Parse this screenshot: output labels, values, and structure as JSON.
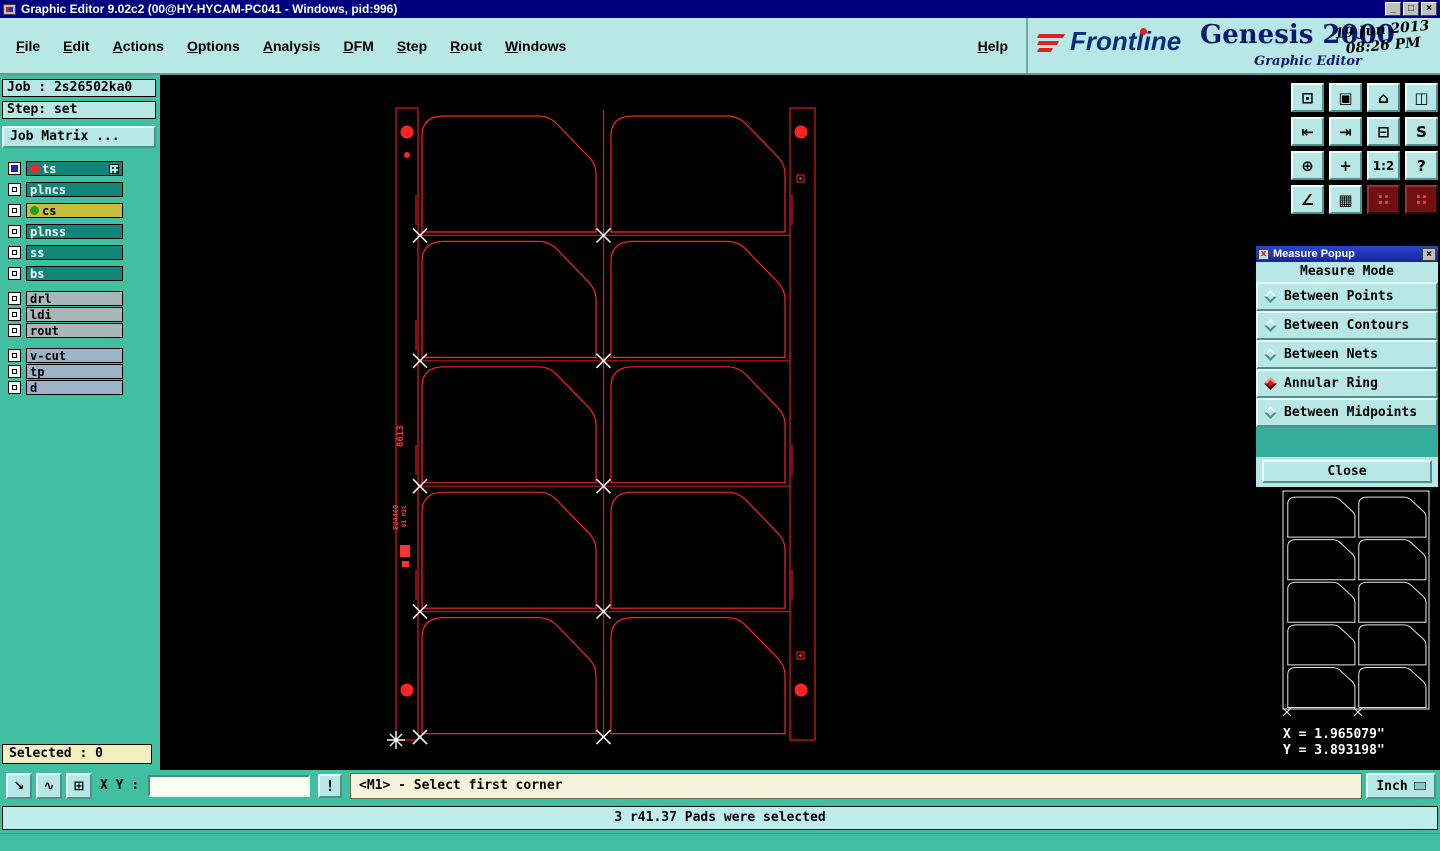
{
  "window": {
    "title": "Graphic Editor 9.02c2 (00@HY-HYCAM-PC041 - Windows, pid:996)",
    "minimize": "_",
    "maximize": "□",
    "close": "×"
  },
  "menubar": {
    "items": [
      "File",
      "Edit",
      "Actions",
      "Options",
      "Analysis",
      "DFM",
      "Step",
      "Rout",
      "Windows"
    ],
    "help": "Help"
  },
  "brand": {
    "name": "Frontline",
    "product": "Genesis 2000",
    "date": "19 Jun 2013",
    "time": "08:26 PM",
    "subtitle": "Graphic Editor"
  },
  "sidebar": {
    "job": "Job : 2s26502ka0",
    "step": "Step: set",
    "job_matrix": "Job Matrix ...",
    "selected": "Selected : 0",
    "layers": [
      {
        "name": "ts"
      },
      {
        "name": "plncs"
      },
      {
        "name": "cs"
      },
      {
        "name": "plnss"
      },
      {
        "name": "ss"
      },
      {
        "name": "bs"
      },
      {
        "name": "drl"
      },
      {
        "name": "ldi"
      },
      {
        "name": "rout"
      },
      {
        "name": "v-cut"
      },
      {
        "name": "tp"
      },
      {
        "name": "d"
      }
    ]
  },
  "toolbar": {
    "buttons": [
      {
        "glyph": "⊡"
      },
      {
        "glyph": "▣"
      },
      {
        "glyph": "⌂"
      },
      {
        "glyph": "◫"
      },
      {
        "glyph": "⇤"
      },
      {
        "glyph": "⇥"
      },
      {
        "glyph": "⊟"
      },
      {
        "glyph": "S"
      },
      {
        "glyph": "⊕"
      },
      {
        "glyph": "+"
      },
      {
        "glyph": "1:2"
      },
      {
        "glyph": "?"
      },
      {
        "glyph": "∠"
      },
      {
        "glyph": "▦"
      },
      {
        "glyph": "∷"
      },
      {
        "glyph": "∷"
      }
    ]
  },
  "measure_popup": {
    "title": "Measure Popup",
    "header": "Measure Mode",
    "options": [
      {
        "label": "Between Points"
      },
      {
        "label": "Between Contours"
      },
      {
        "label": "Between Nets"
      },
      {
        "label": "Annular Ring"
      },
      {
        "label": "Between Midpoints"
      }
    ],
    "selected_option": "Annular Ring",
    "close": "Close"
  },
  "overview": {
    "x_coord": "X = 1.965079\"",
    "y_coord": "Y = 3.893198\""
  },
  "command_bar": {
    "xy_label": "X Y :",
    "input_value": "",
    "alert": "!",
    "prompt": "<M1> - Select first corner",
    "units": "Inch"
  },
  "status_bar": {
    "message": "3 r41.37 Pads were selected"
  },
  "canvas": {
    "markings": [
      "8613",
      "EU4460",
      "DI MIC"
    ]
  },
  "colors": {
    "accent_red": "#ff2020",
    "panel_cyan": "#b8e8e6",
    "teal": "#41bfa0",
    "title_blue": "#00007f"
  }
}
